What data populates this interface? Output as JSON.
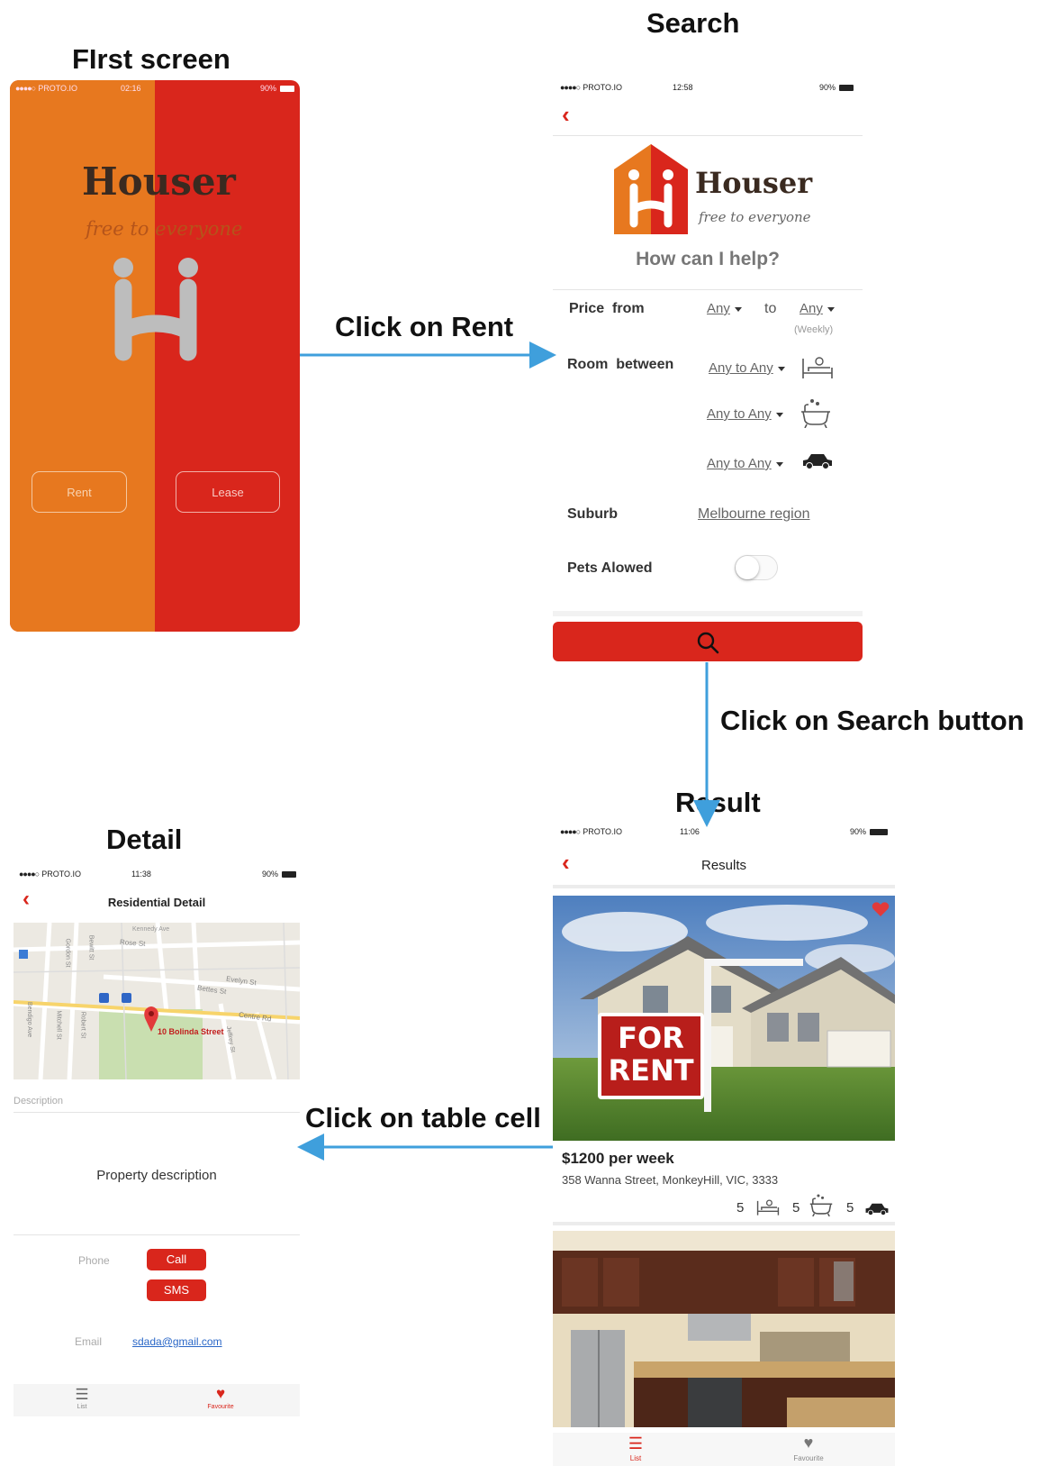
{
  "sections": {
    "first": "FIrst screen",
    "search": "Search",
    "result": "Result",
    "detail": "Detail"
  },
  "steps": {
    "rent": "Click on Rent",
    "search": "Click on Search button",
    "table_cell": "Click on table cell"
  },
  "colors": {
    "orange": "#e7781f",
    "red": "#d9261c",
    "arrow": "#3f9fdc"
  },
  "first_screen": {
    "status": {
      "carrier": "PROTO.IO",
      "time": "02:16",
      "battery": "90%"
    },
    "logo": "Houser",
    "tagline": "free to everyone",
    "logo_icon": "houser-h-icon",
    "rent_button": "Rent",
    "lease_button": "Lease"
  },
  "search_screen": {
    "status": {
      "carrier": "PROTO.IO",
      "time": "12:58",
      "battery": "90%"
    },
    "logo": "Houser",
    "tagline": "free to everyone",
    "heading": "How can I help?",
    "price_label": "Price  from",
    "price_from": "Any",
    "price_to_label": "to",
    "price_to": "Any",
    "price_note": "(Weekly)",
    "room_label": "Room  between",
    "bed_range": "Any to Any",
    "bath_range": "Any to Any",
    "car_range": "Any to Any",
    "suburb_label": "Suburb",
    "suburb_value": "Melbourne region",
    "pets_label": "Pets Alowed",
    "search_icon": "search-icon"
  },
  "result_screen": {
    "status": {
      "carrier": "PROTO.IO",
      "time": "11:06",
      "battery": "90%"
    },
    "title": "Results",
    "sign_line1": "FOR",
    "sign_line2": "RENT",
    "price": "$1200 per week",
    "address": "358 Wanna Street, MonkeyHill, VIC, 3333",
    "beds": "5",
    "baths": "5",
    "cars": "5",
    "tab_list": "List",
    "tab_fav": "Favourite"
  },
  "detail_screen": {
    "status": {
      "carrier": "PROTO.IO",
      "time": "11:38",
      "battery": "90%"
    },
    "title": "Residential Detail",
    "map_pin_label": "10 Bolinda Street",
    "map_streets": [
      "Rose St",
      "Evelyn St",
      "Bettes St",
      "Centre Rd",
      "Kennedy Ave",
      "Gordon St",
      "Jeffrey St",
      "Bendigo Ave",
      "Mitchell St",
      "Robert St",
      "Bewitt St"
    ],
    "description_label": "Description",
    "description": "Property description",
    "phone_label": "Phone",
    "call_button": "Call",
    "sms_button": "SMS",
    "email_label": "Email",
    "email": "sdada@gmail.com",
    "tab_list": "List",
    "tab_fav": "Favourite"
  }
}
